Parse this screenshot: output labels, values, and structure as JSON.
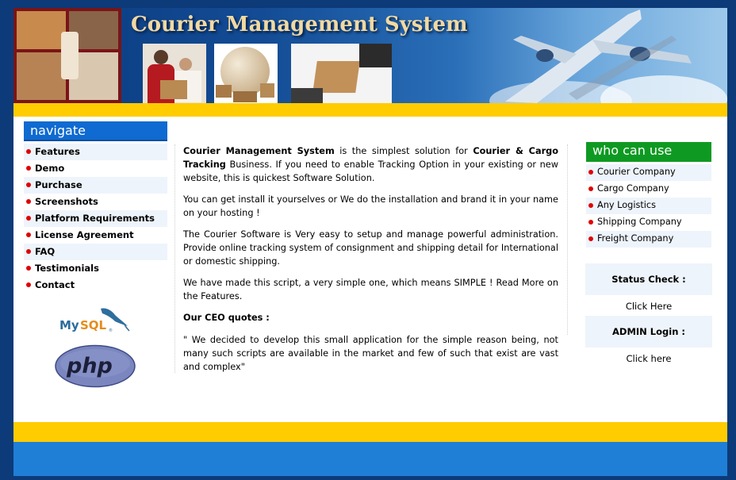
{
  "header": {
    "site_title": "Courier Management System"
  },
  "nav": {
    "heading": "navigate",
    "items": [
      {
        "label": "Features"
      },
      {
        "label": "Demo"
      },
      {
        "label": "Purchase"
      },
      {
        "label": "Screenshots"
      },
      {
        "label": "Platform Requirements"
      },
      {
        "label": "License Agreement"
      },
      {
        "label": "FAQ"
      },
      {
        "label": "Testimonials"
      },
      {
        "label": "Contact"
      }
    ],
    "logos": {
      "mysql": "MySQL",
      "php": "php"
    }
  },
  "main": {
    "p1_bold1": "Courier Management System",
    "p1_text1": " is the simplest solution for ",
    "p1_bold2": "Courier & Cargo Tracking",
    "p1_text2": " Business. If you need to enable Tracking Option in your existing or new website, this is quickest Software Solution.",
    "p2": "You can get install it yourselves or We do the installation and brand it in your name on your hosting !",
    "p3": "The Courier Software is Very easy to setup and manage powerful administration. Provide online tracking system of consignment and shipping detail for International or domestic shipping.",
    "p4": "We have made this script, a very simple one, which means SIMPLE ! Read More on the Features.",
    "ceo_heading": "Our CEO quotes :",
    "ceo_quote": "\" We decided to develop this small application for the simple reason being, not many such scripts are available in the market and few of such that exist are vast and complex\""
  },
  "who": {
    "heading": "who can use",
    "items": [
      {
        "label": "Courier Company"
      },
      {
        "label": "Cargo Company"
      },
      {
        "label": "Any Logistics"
      },
      {
        "label": "Shipping Company"
      },
      {
        "label": "Freight Company"
      }
    ]
  },
  "status": {
    "heading": "Status Check :",
    "link": "Click Here"
  },
  "admin": {
    "heading": "ADMIN Login :",
    "link": "Click here"
  },
  "colors": {
    "page_bg": "#0d3a78",
    "header_blue": "#134c95",
    "yellow": "#ffcc00",
    "nav_blue": "#0f6ad1",
    "who_green": "#0e9a22",
    "bullet_red": "#e00000",
    "title_gold": "#f1d9a1"
  }
}
